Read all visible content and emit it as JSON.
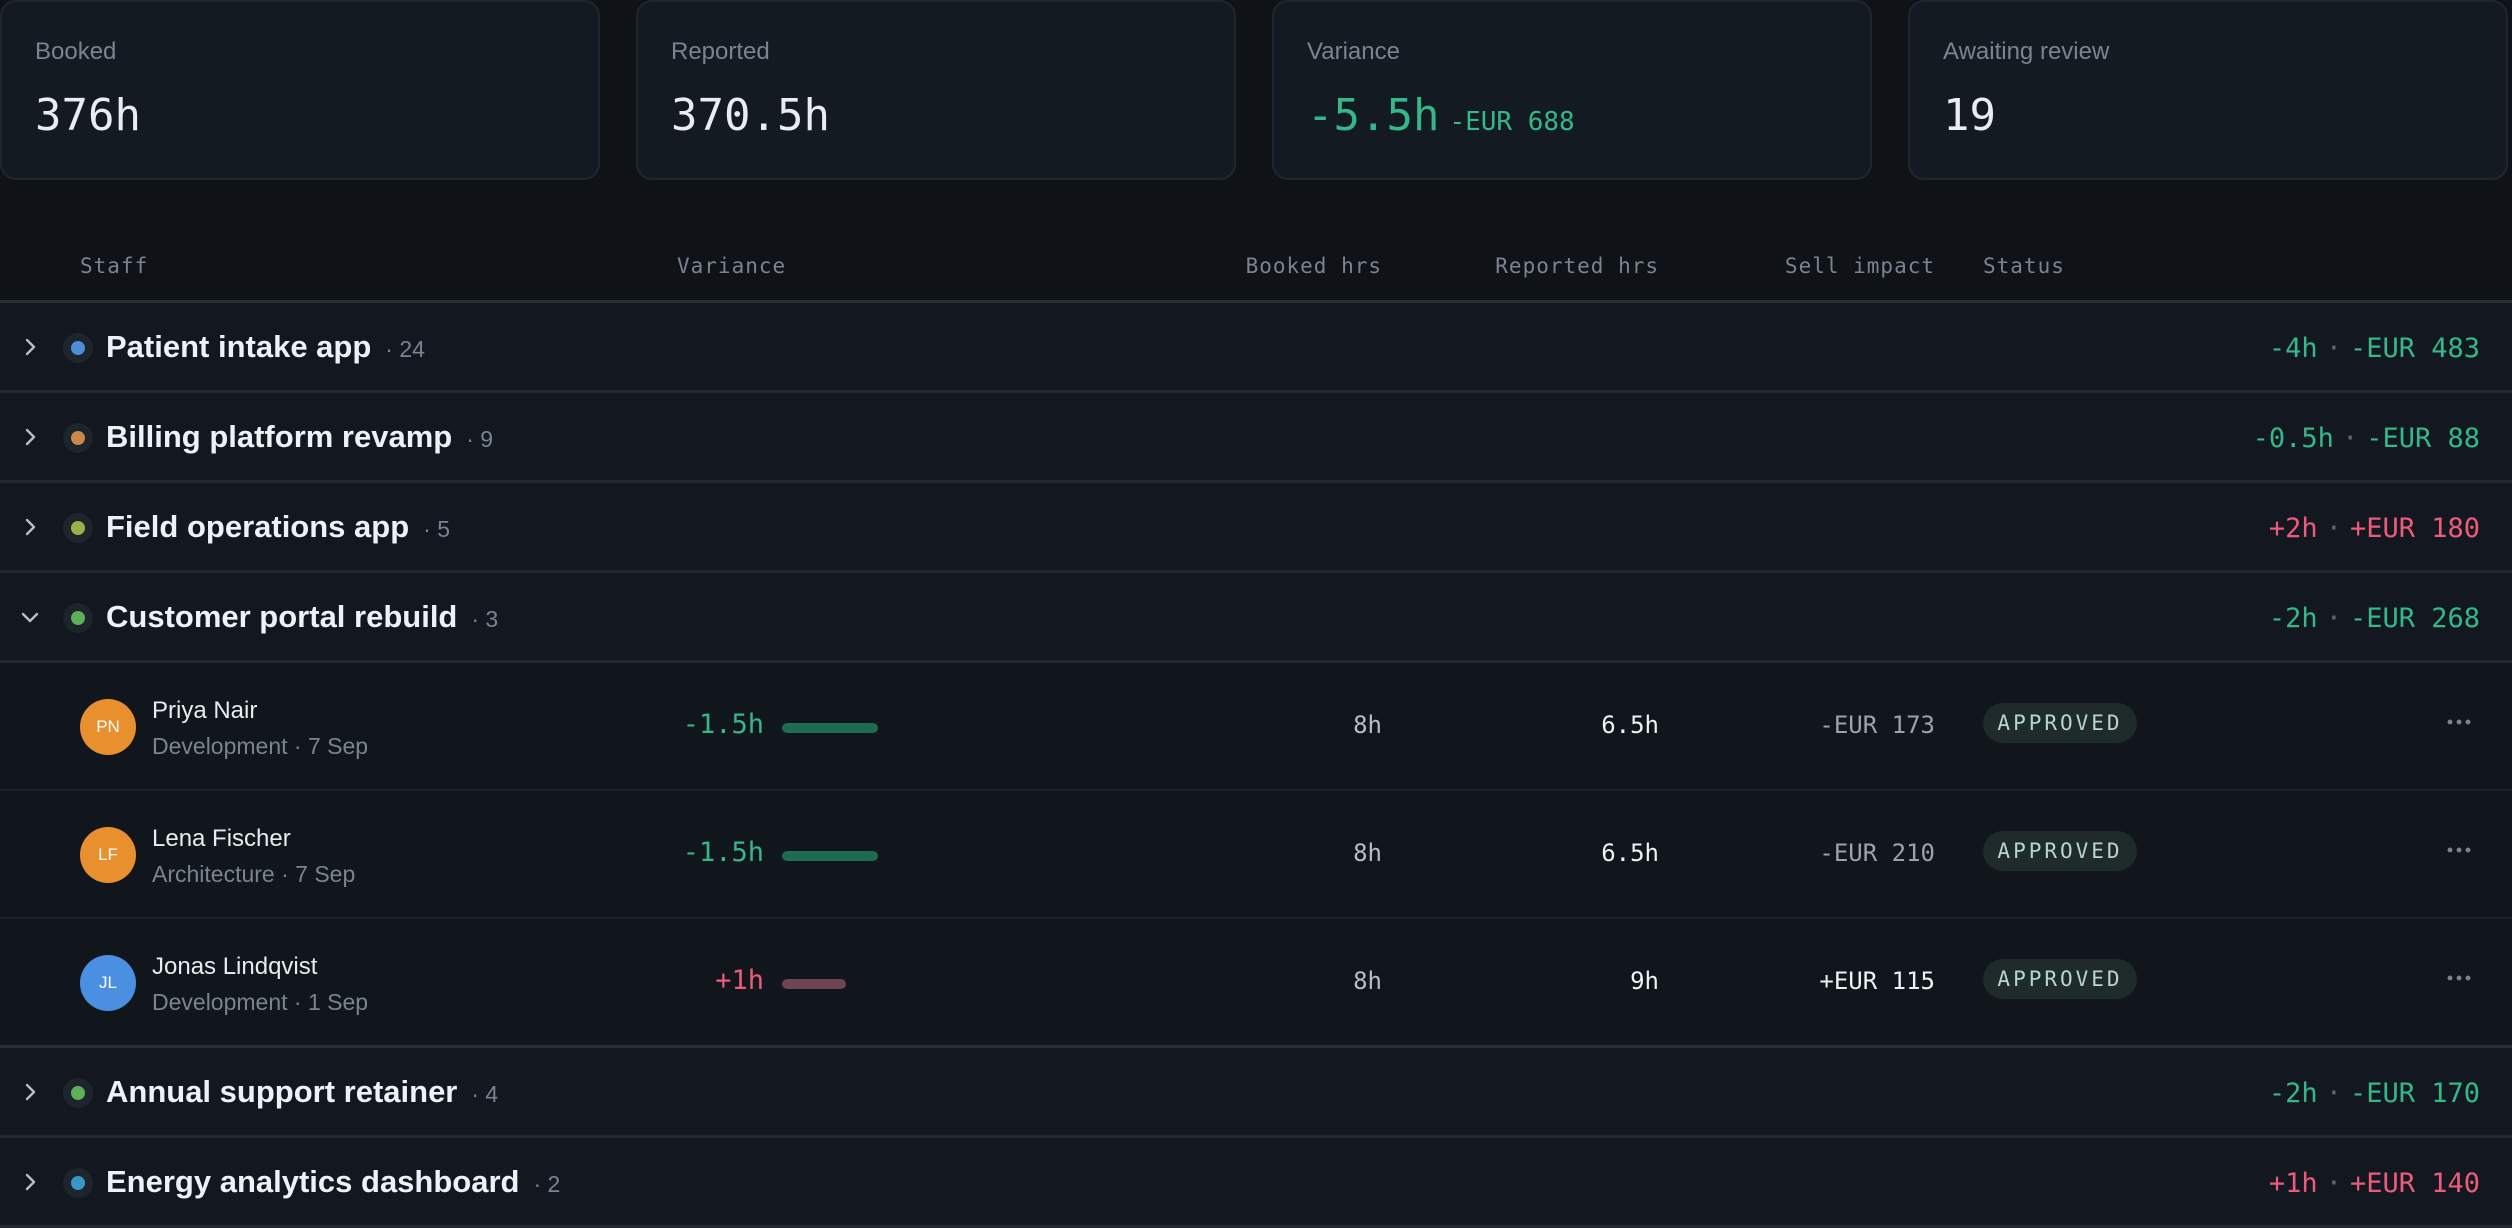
{
  "colors": {
    "positive": "#34b88a",
    "negative": "#ec5c7a",
    "background": "#0f1318",
    "card": "#141a21"
  },
  "kpis": [
    {
      "label": "Booked",
      "value": "376h"
    },
    {
      "label": "Reported",
      "value": "370.5h"
    },
    {
      "label": "Variance",
      "value": "-5.5h",
      "sub": "-EUR 688"
    },
    {
      "label": "Awaiting review",
      "value": "19"
    }
  ],
  "table": {
    "headers": {
      "staff": "Staff",
      "variance": "Variance",
      "booked": "Booked hrs",
      "reported": "Reported hrs",
      "sell": "Sell impact",
      "status": "Status"
    }
  },
  "groups": [
    {
      "name": "Patient intake app",
      "count": "· 24",
      "dot_color": "#4d8fd6",
      "hours": "-4h",
      "amount": "-EUR 483",
      "sign": "pos",
      "expanded": false
    },
    {
      "name": "Billing platform revamp",
      "count": "· 9",
      "dot_color": "#c9884a",
      "hours": "-0.5h",
      "amount": "-EUR 88",
      "sign": "pos",
      "expanded": false
    },
    {
      "name": "Field operations app",
      "count": "· 5",
      "dot_color": "#9ab04a",
      "hours": "+2h",
      "amount": "+EUR 180",
      "sign": "neg",
      "expanded": false
    },
    {
      "name": "Customer portal rebuild",
      "count": "· 3",
      "dot_color": "#5fae58",
      "hours": "-2h",
      "amount": "-EUR 268",
      "sign": "pos",
      "expanded": true
    },
    {
      "name": "Annual support retainer",
      "count": "· 4",
      "dot_color": "#5fae58",
      "hours": "-2h",
      "amount": "-EUR 170",
      "sign": "pos",
      "expanded": false
    },
    {
      "name": "Energy analytics dashboard",
      "count": "· 2",
      "dot_color": "#3a95c9",
      "hours": "+1h",
      "amount": "+EUR 140",
      "sign": "neg",
      "expanded": false
    }
  ],
  "members": [
    {
      "initials": "PN",
      "avatar_color": "#e8902e",
      "name": "Priya Nair",
      "meta": "Development · 7 Sep",
      "variance": "-1.5h",
      "variance_hours": -1.5,
      "booked": "8h",
      "reported": "6.5h",
      "sell": "-EUR 173",
      "status": "APPROVED"
    },
    {
      "initials": "LF",
      "avatar_color": "#e8902e",
      "name": "Lena Fischer",
      "meta": "Architecture · 7 Sep",
      "variance": "-1.5h",
      "variance_hours": -1.5,
      "booked": "8h",
      "reported": "6.5h",
      "sell": "-EUR 210",
      "status": "APPROVED"
    },
    {
      "initials": "JL",
      "avatar_color": "#4a8fe0",
      "name": "Jonas Lindqvist",
      "meta": "Development · 1 Sep",
      "variance": "+1h",
      "variance_hours": 1,
      "booked": "8h",
      "reported": "9h",
      "sell": "+EUR 115",
      "status": "APPROVED"
    }
  ]
}
